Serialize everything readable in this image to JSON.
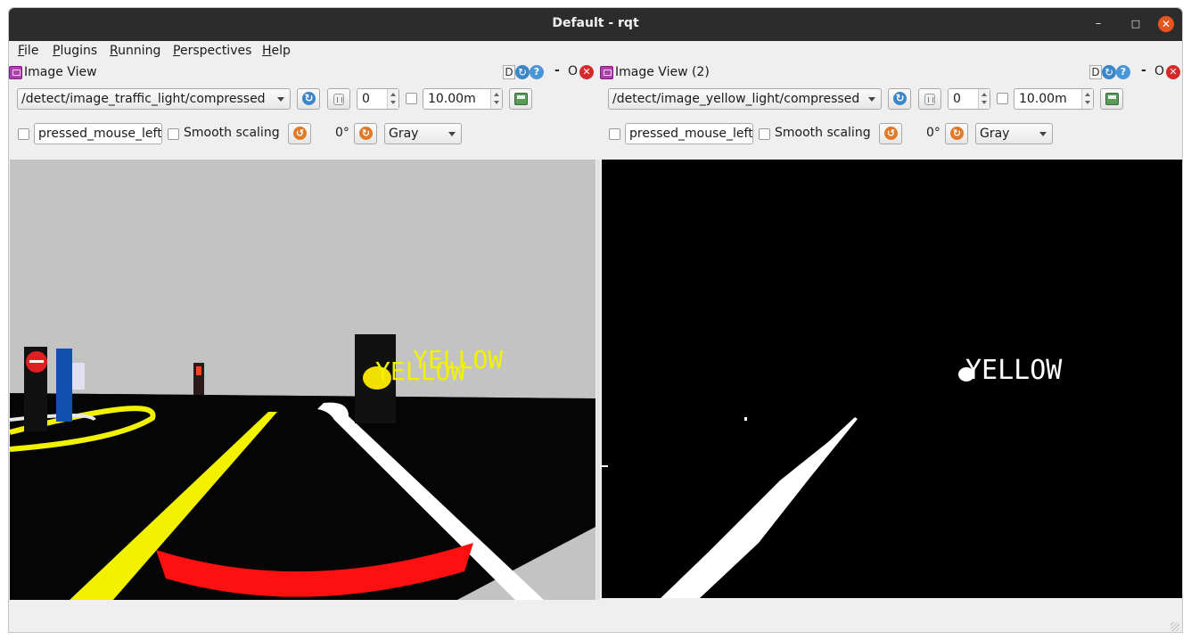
{
  "window": {
    "title": "Default - rqt"
  },
  "window_controls": {
    "minimize": "–",
    "maximize": "□",
    "close": "✕"
  },
  "menu": [
    "File",
    "Plugins",
    "Running",
    "Perspectives",
    "Help"
  ],
  "panels": [
    {
      "title": "Image View",
      "topic": "/detect/image_traffic_light/compressed",
      "spin_value": "0",
      "duration": "10.00m",
      "mouse_topic": "pressed_mouse_left",
      "smooth_label": "Smooth scaling",
      "rotation": "0°",
      "color_mode": "Gray"
    },
    {
      "title": "Image View (2)",
      "topic": "/detect/image_yellow_light/compressed",
      "spin_value": "0",
      "duration": "10.00m",
      "mouse_topic": "pressed_mouse_left",
      "smooth_label": "Smooth scaling",
      "rotation": "0°",
      "color_mode": "Gray"
    }
  ],
  "header_buttons": {
    "dock": "D",
    "reload": "↻",
    "help": "?",
    "minimize": "-",
    "float": "O",
    "close": "✕"
  },
  "toolbar_glyphs": {
    "refresh": "↻",
    "rotate_left": "↺",
    "rotate_right": "↻"
  },
  "scene": {
    "left_overlay_text": [
      "YELLOW",
      "YELLOW"
    ],
    "right_overlay_text": "YELLOW",
    "colors": {
      "road": "#050505",
      "sky": "#c3c3c3",
      "yellow_line": "#f2f200",
      "red_arc": "#ff1010",
      "white_line": "#ffffff"
    }
  },
  "icons": {
    "plugin": "image-view-plugin-icon",
    "dock": "dock-icon",
    "reload": "reload-icon",
    "help": "help-icon",
    "close": "close-icon"
  }
}
